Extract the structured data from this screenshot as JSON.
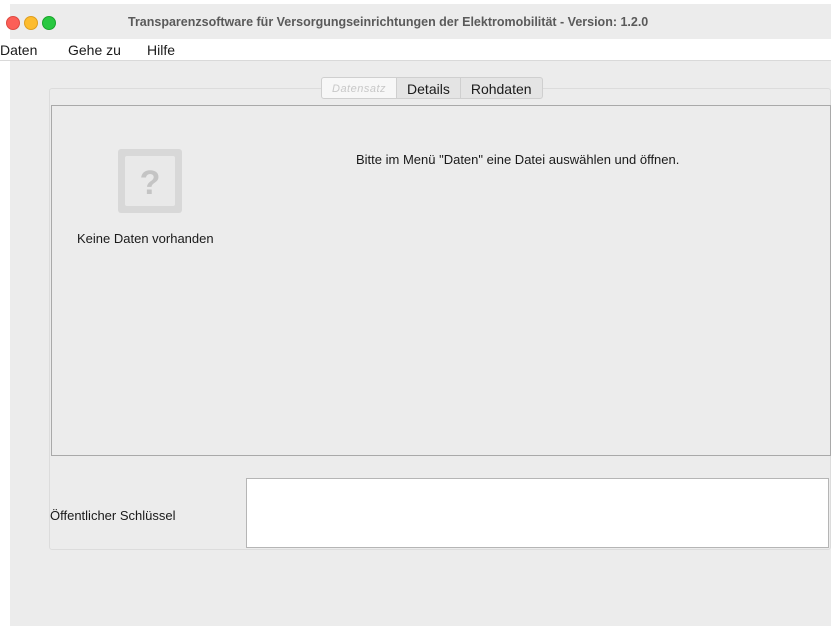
{
  "window": {
    "title": "Transparenzsoftware für Versorgungseinrichtungen der Elektromobilität - Version: 1.2.0"
  },
  "menu": {
    "items": [
      "Daten",
      "Gehe zu",
      "Hilfe"
    ]
  },
  "tabs": [
    {
      "label": "Datensatz",
      "active": true
    },
    {
      "label": "Details",
      "active": false
    },
    {
      "label": "Rohdaten",
      "active": false
    }
  ],
  "content": {
    "icon": "question-mark-document-icon",
    "no_data_label": "Keine Daten vorhanden",
    "instruction": "Bitte im Menü \"Daten\" eine Datei auswählen und öffnen."
  },
  "public_key": {
    "label": "Öffentlicher Schlüssel",
    "value": ""
  },
  "colors": {
    "close": "#fc5f57",
    "minimize": "#fdbc2e",
    "zoom": "#28c840",
    "window_bg": "#ececec"
  }
}
